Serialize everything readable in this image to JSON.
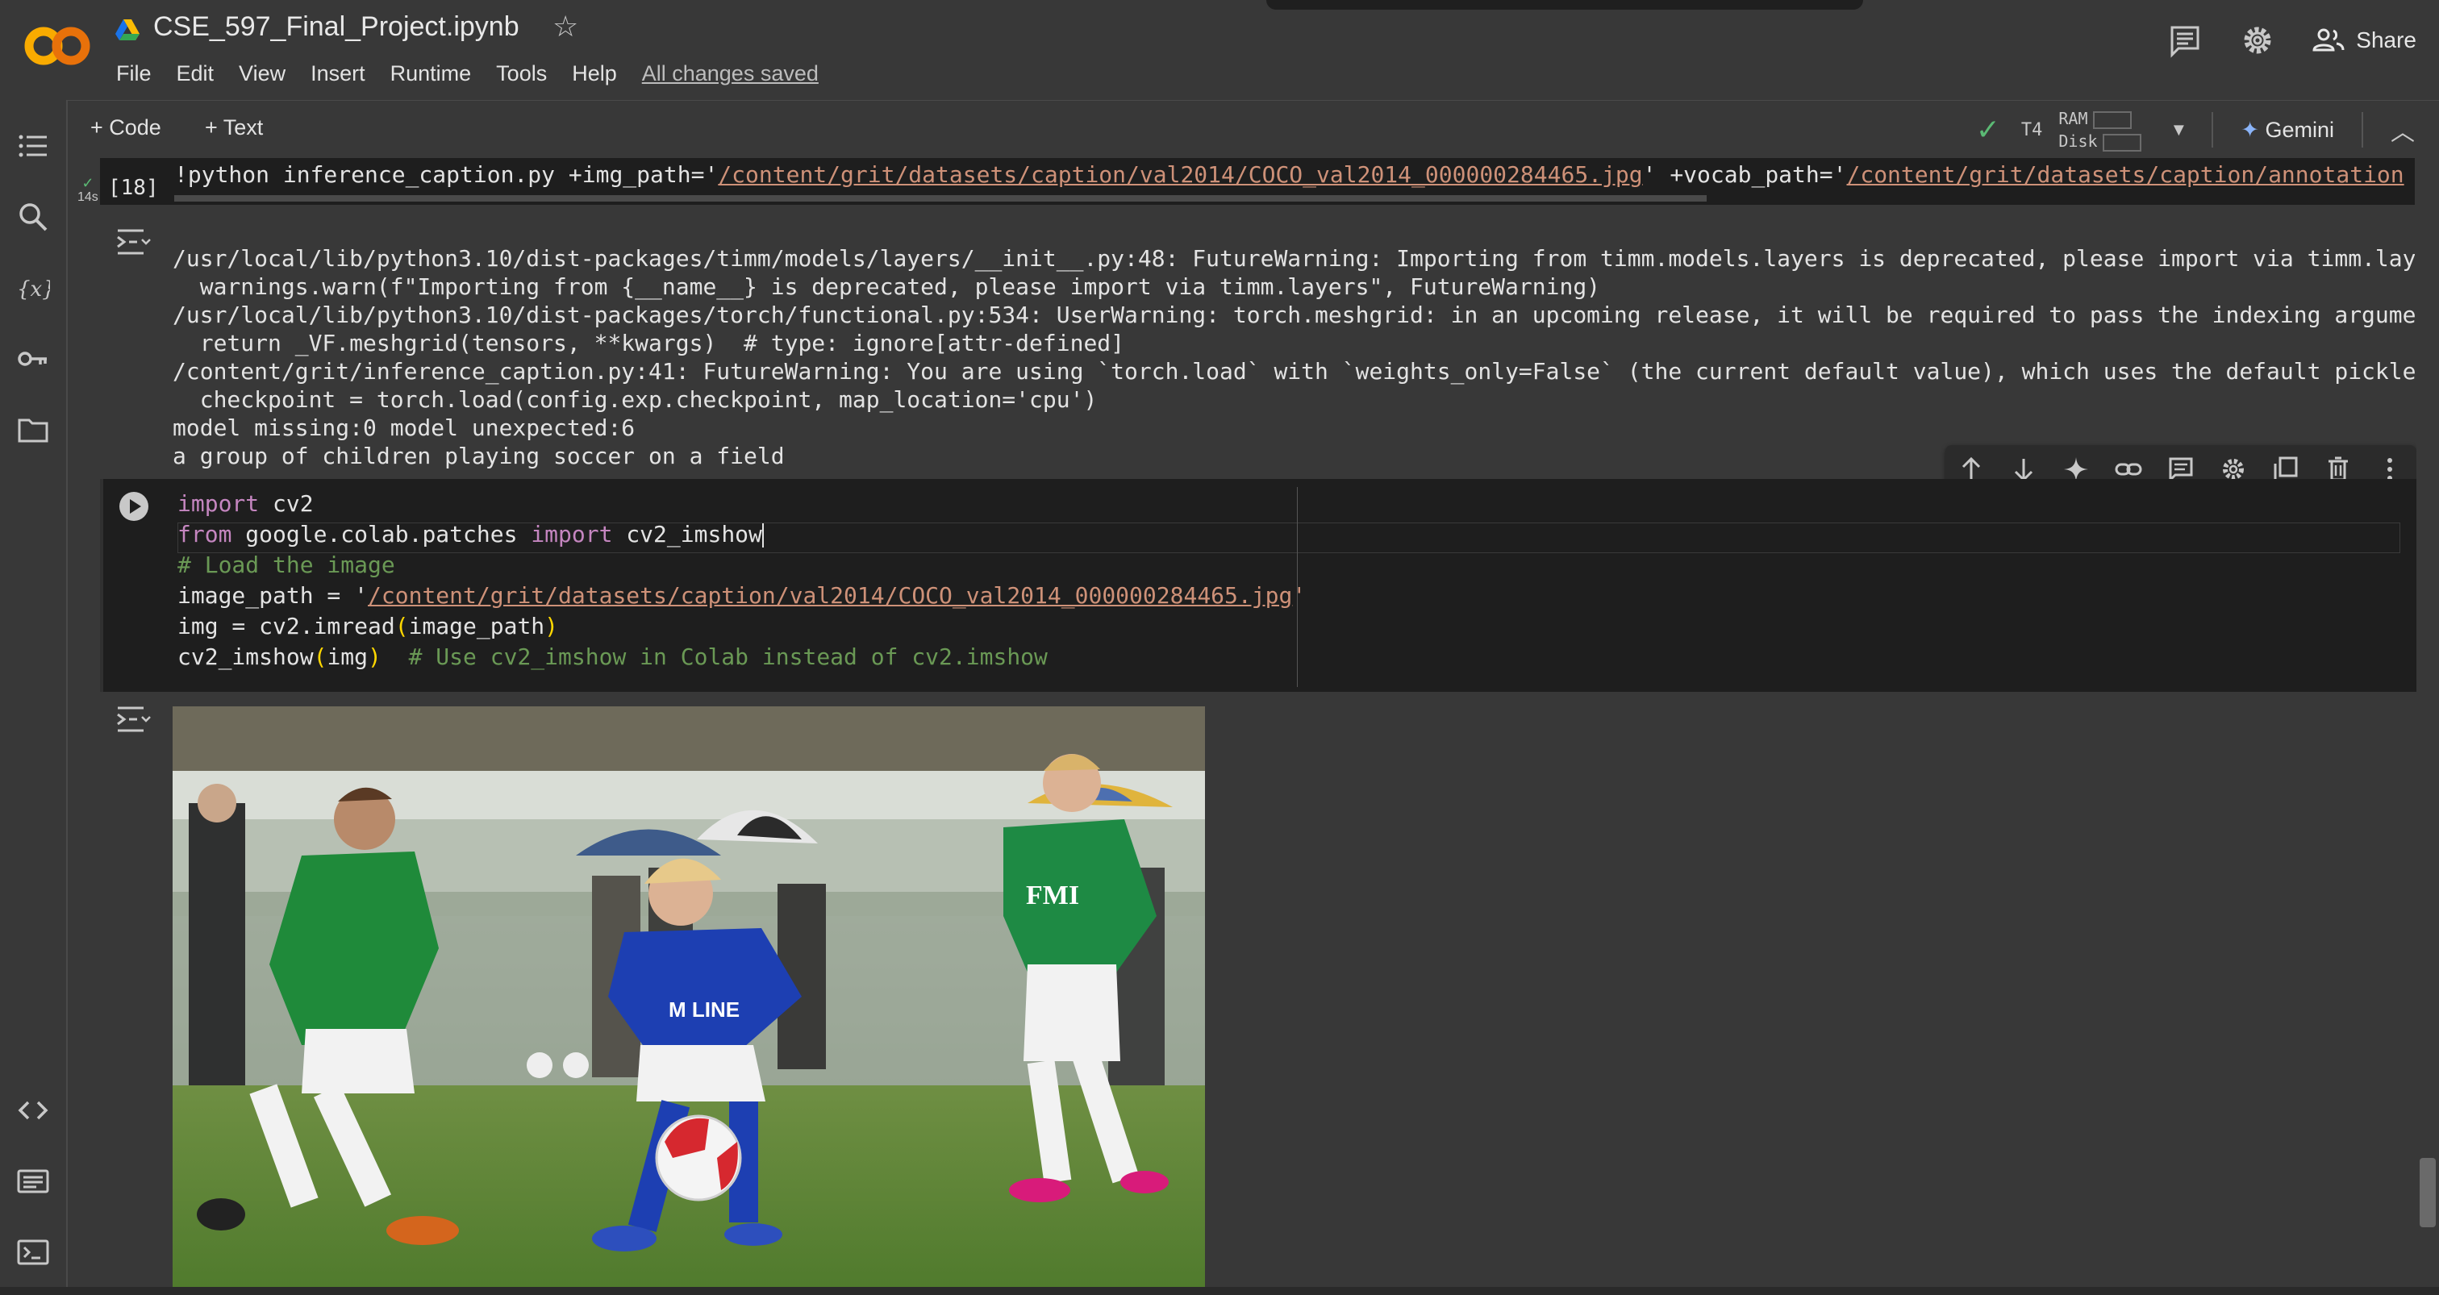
{
  "header": {
    "file_title": "CSE_597_Final_Project.ipynb",
    "menu": [
      "File",
      "Edit",
      "View",
      "Insert",
      "Runtime",
      "Tools",
      "Help"
    ],
    "save_status": "All changes saved",
    "share_label": "Share"
  },
  "toolbar": {
    "add_code": "+ Code",
    "add_text": "+ Text",
    "runtime_type": "T4",
    "ram_label": "RAM",
    "disk_label": "Disk",
    "gemini_label": "Gemini"
  },
  "cell18": {
    "execution_count": "[18]",
    "elapsed": "14s",
    "code_parts": {
      "pre": "!python inference_caption.py +img_path='",
      "img_path": "/content/grit/datasets/caption/val2014/COCO_val2014_000000284465.jpg",
      "mid": "' +vocab_path='",
      "vocab_path": "/content/grit/datasets/caption/annotation"
    },
    "output_lines": [
      "/usr/local/lib/python3.10/dist-packages/timm/models/layers/__init__.py:48: FutureWarning: Importing from timm.models.layers is deprecated, please import via timm.lay",
      "  warnings.warn(f\"Importing from {__name__} is deprecated, please import via timm.layers\", FutureWarning)",
      "/usr/local/lib/python3.10/dist-packages/torch/functional.py:534: UserWarning: torch.meshgrid: in an upcoming release, it will be required to pass the indexing argume",
      "  return _VF.meshgrid(tensors, **kwargs)  # type: ignore[attr-defined]",
      "/content/grit/inference_caption.py:41: FutureWarning: You are using `torch.load` with `weights_only=False` (the current default value), which uses the default pickle",
      "  checkpoint = torch.load(config.exp.checkpoint, map_location='cpu')",
      "model missing:0 model unexpected:6",
      "a group of children playing soccer on a field"
    ]
  },
  "current_cell": {
    "l1_kw": "import",
    "l1_rest": " cv2",
    "l2_kw1": "from",
    "l2_mid": " google.colab.patches ",
    "l2_kw2": "import",
    "l2_rest": " cv2_imshow",
    "l3_comment": "# Load the image",
    "l4_pre": "image_path = '",
    "l4_str": "/content/grit/datasets/caption/val2014/COCO_val2014_000000284465.jpg",
    "l4_post": "'",
    "l5_pre": "img = cv2.imread",
    "l5_open": "(",
    "l5_arg": "image_path",
    "l5_close": ")",
    "l6_pre": "cv2_imshow",
    "l6_open": "(",
    "l6_arg": "img",
    "l6_close": ")",
    "l6_comment": "  # Use cv2_imshow in Colab instead of cv2.imshow"
  },
  "output_image": {
    "jersey_text_1": "FMI",
    "jersey_text_2": "M LINE"
  },
  "colors": {
    "background": "#383838",
    "code_bg": "#1e1e1e",
    "string": "#ce9178",
    "keyword": "#c586c0",
    "comment": "#6a9955",
    "check_green": "#5bb974",
    "gemini_blue": "#8ab4f8"
  }
}
